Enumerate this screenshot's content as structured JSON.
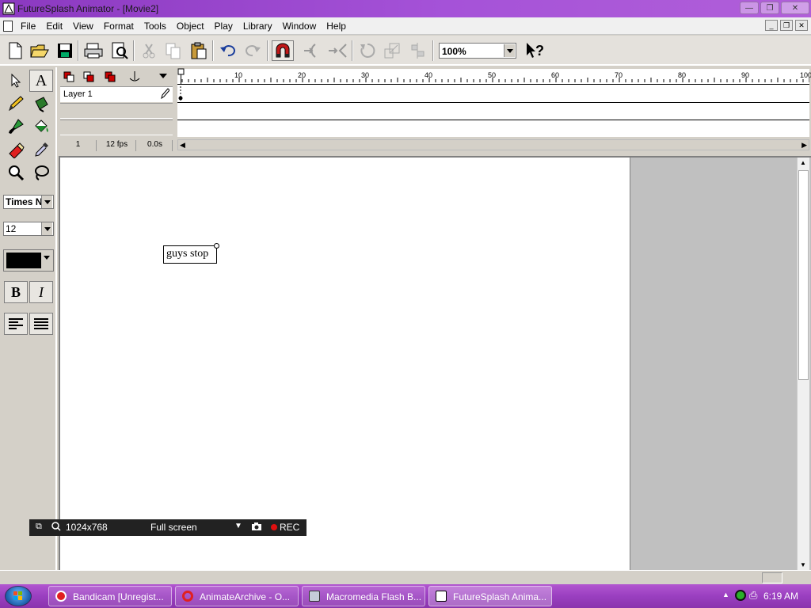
{
  "window": {
    "title": "FutureSplash Animator - [Movie2]"
  },
  "menu": {
    "items": [
      "File",
      "Edit",
      "View",
      "Format",
      "Tools",
      "Object",
      "Play",
      "Library",
      "Window",
      "Help"
    ]
  },
  "toolbar": {
    "zoom": "100%"
  },
  "tools": {
    "font": "Times N",
    "size": "12",
    "bold_label": "B",
    "italic_label": "I",
    "fill_color": "#000000"
  },
  "timeline": {
    "layers": [
      "Layer 1"
    ],
    "ruler_ticks": [
      "10",
      "20",
      "30",
      "40",
      "50",
      "60",
      "70",
      "80",
      "90",
      "100"
    ],
    "current_frame": "1",
    "frame_rate": "12 fps",
    "elapsed": "0.0s"
  },
  "stage": {
    "text": "guys stop"
  },
  "recorder": {
    "resolution": "1024x768",
    "mode": "Full screen",
    "rec_label": "REC"
  },
  "taskbar": {
    "tasks": [
      {
        "label": "Bandicam [Unregist..."
      },
      {
        "label": "AnimateArchive - O..."
      },
      {
        "label": "Macromedia Flash B..."
      },
      {
        "label": "FutureSplash Anima..."
      }
    ],
    "clock": "6:19 AM"
  }
}
